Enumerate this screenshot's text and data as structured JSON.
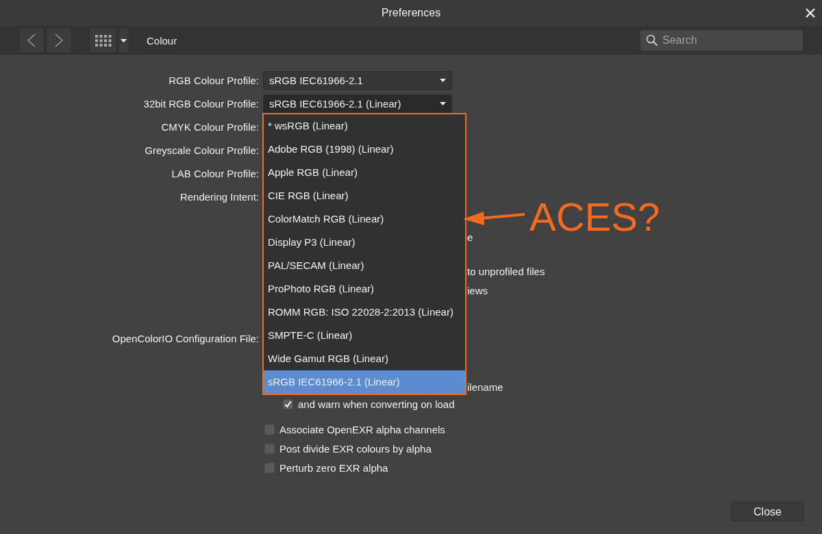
{
  "window": {
    "title": "Preferences"
  },
  "toolbar": {
    "section": "Colour",
    "search": {
      "placeholder": "Search"
    }
  },
  "profiles": [
    {
      "label": "RGB Colour Profile:",
      "kind": "select",
      "value": "sRGB IEC61966-2.1",
      "open": false
    },
    {
      "label": "32bit RGB Colour Profile:",
      "kind": "select",
      "value": "sRGB IEC61966-2.1 (Linear)",
      "open": true
    },
    {
      "label": "CMYK Colour Profile:",
      "kind": "label"
    },
    {
      "label": "Greyscale Colour Profile:",
      "kind": "label"
    },
    {
      "label": "LAB Colour Profile:",
      "kind": "label"
    },
    {
      "label": "Rendering Intent:",
      "kind": "label"
    }
  ],
  "dropdown": {
    "options": [
      {
        "label": "* wsRGB (Linear)",
        "selected": false
      },
      {
        "label": "Adobe RGB (1998) (Linear)",
        "selected": false
      },
      {
        "label": "Apple RGB (Linear)",
        "selected": false
      },
      {
        "label": "CIE RGB (Linear)",
        "selected": false
      },
      {
        "label": "ColorMatch RGB (Linear)",
        "selected": false
      },
      {
        "label": "Display P3 (Linear)",
        "selected": false
      },
      {
        "label": "PAL/SECAM (Linear)",
        "selected": false
      },
      {
        "label": "ProPhoto RGB (Linear)",
        "selected": false
      },
      {
        "label": "ROMM RGB: ISO 22028-2:2013 (Linear)",
        "selected": false
      },
      {
        "label": "SMPTE-C (Linear)",
        "selected": false
      },
      {
        "label": "Wide Gamut RGB (Linear)",
        "selected": false
      },
      {
        "label": "sRGB IEC61966-2.1 (Linear)",
        "selected": true
      }
    ]
  },
  "covered_fragments": [
    "e",
    "to unprofiled files",
    "iews"
  ],
  "ocio_label": "OpenColorIO Configuration File:",
  "filename_fragment": "ilename",
  "warn_option": {
    "label": "and warn when converting on load",
    "checked": true
  },
  "exr_options": [
    {
      "label": "Associate OpenEXR alpha channels",
      "checked": false
    },
    {
      "label": "Post divide EXR colours by alpha",
      "checked": false
    },
    {
      "label": "Perturb zero EXR alpha",
      "checked": false
    }
  ],
  "annotation": {
    "text": "ACES?"
  },
  "close_button": "Close"
}
